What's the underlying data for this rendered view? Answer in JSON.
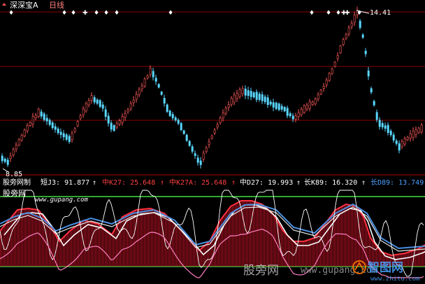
{
  "header": {
    "stock_name": "深深宝A",
    "period": "日线"
  },
  "price_panel": {
    "high_label": "14.41",
    "low_label": "8.85"
  },
  "indicator_panel": {
    "title": "股旁网制",
    "short_label": "短J3: 91.877",
    "short_arrow": "↑",
    "mid_k27": "中K27: 25.648",
    "mid_k27_arrow": "↑",
    "mid_k27a": "中K27A: 25.648",
    "mid_k27a_arrow": "↑",
    "mid_d27": "中D27: 19.993",
    "mid_d27_arrow": "↑",
    "long_k89": "长K89: 16.320",
    "long_k89_arrow": "↑",
    "long_d89": "长D89: 13.749",
    "site_label": "股旁网",
    "site_url": "www.gupang.com"
  },
  "watermark": {
    "text": "股旁网",
    "url": "www.gupang.com",
    "logo": "智图网",
    "logo_url": "www.zhitu.com"
  },
  "colors": {
    "background": "#000000",
    "up_candle": "#ff5a5a",
    "down_candle": "#5ad7ff",
    "grid": "#8b0000",
    "axis": "#b00000",
    "short_line": "#ffffff",
    "mid_k27": "#ff4040",
    "mid_d27": "#ffffff",
    "long_k89": "#e8e8e8",
    "long_d89": "#4a8fe0",
    "pink_line": "#ff80c0",
    "green_line": "#40e040",
    "text_white": "#ffffff"
  }
}
